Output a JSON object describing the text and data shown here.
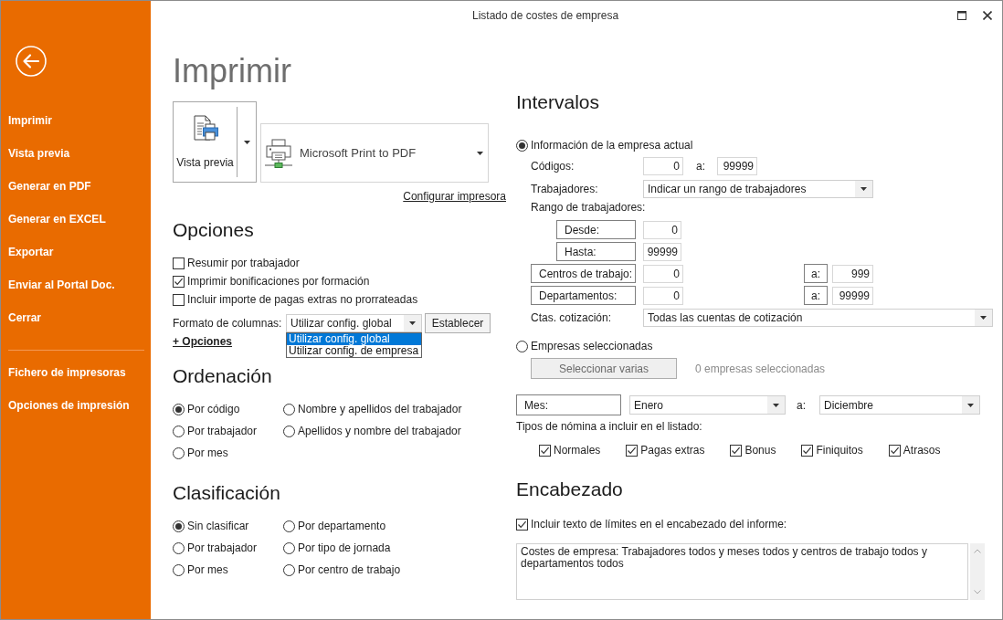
{
  "window": {
    "title": "Listado de costes de empresa"
  },
  "sidebar": {
    "items": [
      "Imprimir",
      "Vista previa",
      "Generar en PDF",
      "Generar en EXCEL",
      "Exportar",
      "Enviar al Portal Doc.",
      "Cerrar"
    ],
    "bottom_items": [
      "Fichero de impresoras",
      "Opciones de impresión"
    ]
  },
  "page_title": "Imprimir",
  "print": {
    "preview_button": "Vista previa",
    "printer": "Microsoft Print to PDF",
    "configure_link": "Configurar impresora"
  },
  "options": {
    "heading": "Opciones",
    "checkboxes": [
      {
        "label": "Resumir por trabajador",
        "checked": false
      },
      {
        "label": "Imprimir bonificaciones por formación",
        "checked": true
      },
      {
        "label": "Incluir importe de pagas extras no prorrateadas",
        "checked": false
      }
    ],
    "column_format": {
      "label": "Formato de columnas:",
      "value": "Utilizar config. global",
      "expanded": true,
      "options": [
        {
          "label": "Utilizar config. global",
          "selected": true
        },
        {
          "label": "Utilizar config. de empresa",
          "selected": false
        }
      ]
    },
    "apply_button": "Establecer",
    "more_link": "+ Opciones"
  },
  "sorting": {
    "heading": "Ordenación",
    "choices": [
      {
        "label": "Por código",
        "selected": true
      },
      {
        "label": "Nombre y apellidos del trabajador",
        "selected": false
      },
      {
        "label": "Por trabajador",
        "selected": false
      },
      {
        "label": "Apellidos y nombre del trabajador",
        "selected": false
      },
      {
        "label": "Por mes",
        "selected": false
      }
    ]
  },
  "classification": {
    "heading": "Clasificación",
    "choices": [
      {
        "label": "Sin clasificar",
        "selected": true
      },
      {
        "label": "Por departamento",
        "selected": false
      },
      {
        "label": "Por trabajador",
        "selected": false
      },
      {
        "label": "Por tipo de jornada",
        "selected": false
      },
      {
        "label": "Por mes",
        "selected": false
      },
      {
        "label": "Por centro de trabajo",
        "selected": false
      }
    ]
  },
  "intervals": {
    "heading": "Intervalos",
    "current_company": {
      "label": "Información de la empresa actual",
      "selected": true
    },
    "codes": {
      "label": "Códigos:",
      "from": "0",
      "to_label": "a:",
      "to": "99999"
    },
    "workers": {
      "label": "Trabajadores:",
      "value": "Indicar un rango de trabajadores"
    },
    "worker_range": {
      "label": "Rango de trabajadores:",
      "from_label": "Desde:",
      "from": "0",
      "to_label": "Hasta:",
      "to": "99999"
    },
    "work_centers": {
      "label": "Centros de trabajo:",
      "from": "0",
      "to_label": "a:",
      "to": "999"
    },
    "departments": {
      "label": "Departamentos:",
      "from": "0",
      "to_label": "a:",
      "to": "99999"
    },
    "contribution_accounts": {
      "label": "Ctas. cotización:",
      "value": "Todas las cuentas de cotización"
    },
    "selected_companies": {
      "label": "Empresas seleccionadas",
      "selected": false,
      "button": "Seleccionar varias",
      "disabled": true,
      "count": "0 empresas seleccionadas"
    },
    "months": {
      "label": "Mes:",
      "from": "Enero",
      "to_label": "a:",
      "to": "Diciembre"
    },
    "payroll_types": {
      "label": "Tipos de nómina a incluir en el listado:",
      "items": [
        {
          "label": "Normales",
          "checked": true
        },
        {
          "label": "Pagas extras",
          "checked": true
        },
        {
          "label": "Bonus",
          "checked": true
        },
        {
          "label": "Finiquitos",
          "checked": true
        },
        {
          "label": "Atrasos",
          "checked": true
        }
      ]
    }
  },
  "header": {
    "heading": "Encabezado",
    "include_limits": {
      "label": "Incluir texto de límites en el encabezado del informe:",
      "checked": true
    },
    "text": "Costes de empresa: Trabajadores todos y meses todos y centros de trabajo todos y departamentos todos"
  }
}
